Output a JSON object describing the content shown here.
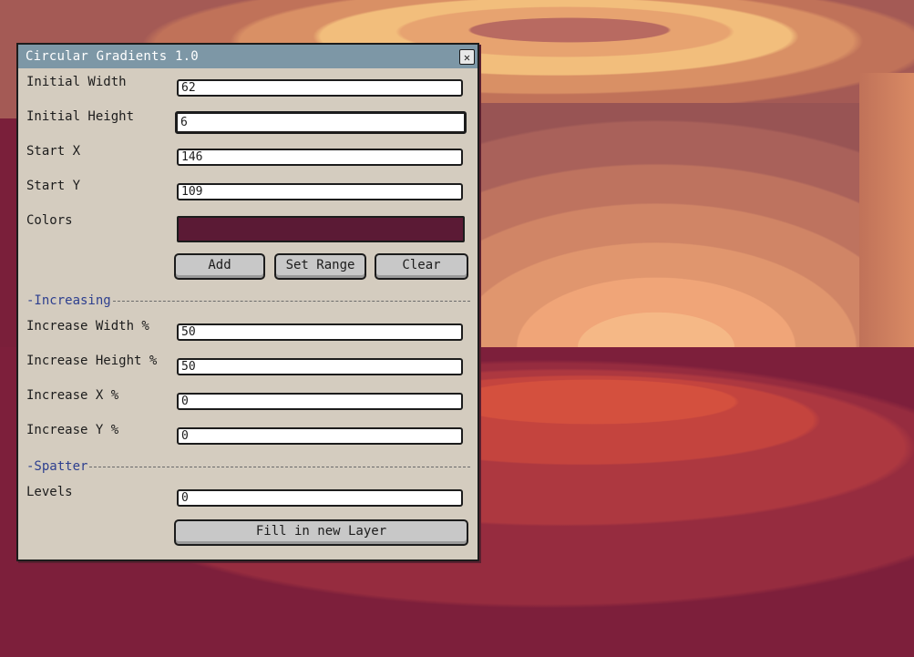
{
  "window": {
    "title": "Circular Gradients 1.0",
    "close_glyph": "✕",
    "close_icon": "close-icon"
  },
  "fields": {
    "initial_width": {
      "label": "Initial Width",
      "value": "62"
    },
    "initial_height": {
      "label": "Initial Height",
      "value": "6"
    },
    "start_x": {
      "label": "Start X",
      "value": "146"
    },
    "start_y": {
      "label": "Start Y",
      "value": "109"
    }
  },
  "colors": {
    "label": "Colors",
    "swatch_color": "#5b1a35"
  },
  "buttons": {
    "add": "Add",
    "set_range": "Set Range",
    "clear": "Clear",
    "fill": "Fill in new Layer"
  },
  "increasing": {
    "section_label": "-Increasing",
    "increase_width": {
      "label": "Increase Width %",
      "value": "50"
    },
    "increase_height": {
      "label": "Increase Height %",
      "value": "50"
    },
    "increase_x": {
      "label": "Increase X %",
      "value": "0"
    },
    "increase_y": {
      "label": "Increase Y %",
      "value": "0"
    }
  },
  "spatter": {
    "section_label": "-Spatter",
    "levels": {
      "label": "Levels",
      "value": "0"
    }
  },
  "theme": {
    "titlebar": "#7d97a6",
    "panel": "#d4ccbf",
    "section_text": "#2d3f8f"
  }
}
